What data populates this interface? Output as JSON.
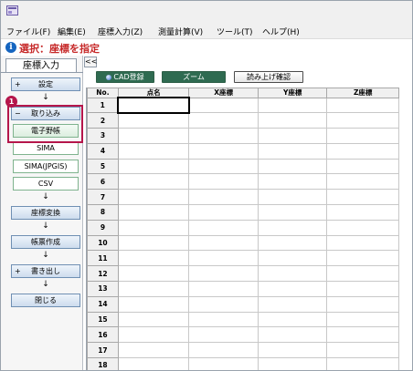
{
  "menu": {
    "items": [
      "ファイル(F)",
      "編集(E)",
      "座標入力(Z)",
      "測量計算(V)",
      "ツール(T)",
      "ヘルプ(H)"
    ]
  },
  "status": {
    "text": "選択：座標を指定"
  },
  "colors": {
    "status_red": "#c62828",
    "highlight": "#b5164b",
    "tool_green": "#2f6b51",
    "nav_blue": "#6f8fb3"
  },
  "left_panel": {
    "tab_label": "座標入力",
    "collapse_label": "<<",
    "setting": {
      "prefix": "+",
      "label": "設定"
    },
    "import": {
      "prefix": "−",
      "label": "取り込み"
    },
    "sub_items": [
      "電子野帳",
      "SIMA",
      "SIMA(JPGIS)",
      "CSV"
    ],
    "selected_sub": "電子野帳",
    "convert_label": "座標変換",
    "report_label": "帳票作成",
    "export": {
      "prefix": "+",
      "label": "書き出し"
    },
    "close_label": "閉じる",
    "arrow_glyph": "↓",
    "badge": "1"
  },
  "toolbar": {
    "cad_label": "CAD登録",
    "zoom_label": "ズーム",
    "readout_label": "読み上げ確認"
  },
  "grid": {
    "columns": [
      "No.",
      "点名",
      "X座標",
      "Y座標",
      "Z座標"
    ],
    "rows": [
      "1",
      "2",
      "3",
      "4",
      "5",
      "6",
      "7",
      "8",
      "9",
      "10",
      "11",
      "12",
      "13",
      "14",
      "15",
      "16",
      "17",
      "18"
    ]
  }
}
